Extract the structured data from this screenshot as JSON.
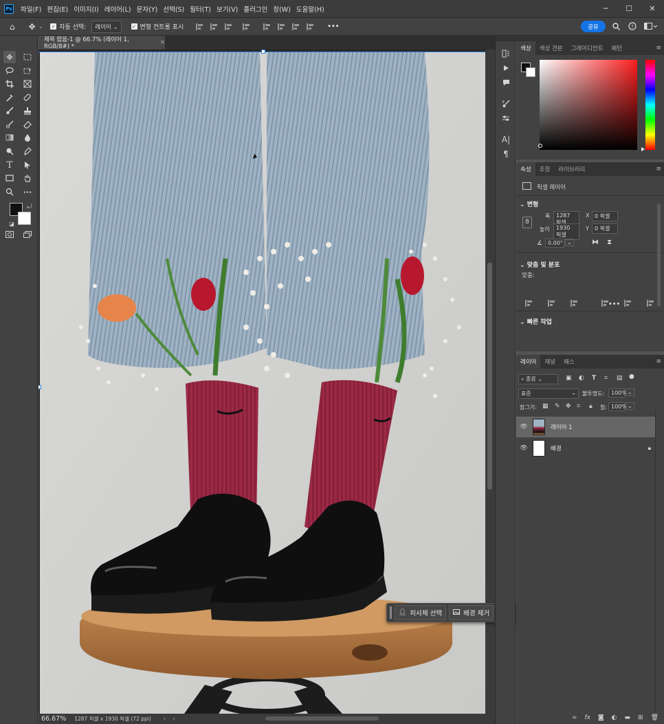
{
  "app": {
    "logo": "Ps"
  },
  "menu": [
    "파일(F)",
    "편집(E)",
    "이미지(I)",
    "레이어(L)",
    "문자(Y)",
    "선택(S)",
    "필터(T)",
    "보기(V)",
    "플러그인",
    "창(W)",
    "도움말(H)"
  ],
  "window_controls": {
    "minimize": "─",
    "maximize": "☐",
    "close": "✕"
  },
  "options_bar": {
    "auto_select_label": "자동 선택:",
    "auto_select_value": "레이어",
    "transform_controls_label": "변형 컨트롤 표시",
    "more": "•••",
    "share_label": "공유"
  },
  "document": {
    "tab_title": "제목 없음-1 @ 66.7% (레이어 1, RGB/8#) *",
    "tab_close": "×",
    "zoom": "66.67%",
    "doc_info": "1287 픽셀 x 1930 픽셀 (72 ppi)"
  },
  "context_bar": {
    "select_subject": "피사체 선택",
    "remove_background": "배경 제거",
    "more": "•••"
  },
  "color_panel": {
    "tabs": [
      "색상",
      "색상 견본",
      "그레이디언트",
      "패턴"
    ],
    "foreground": "#111111",
    "background": "#ffffff",
    "hue": "#ff1e1e"
  },
  "properties_panel": {
    "tabs": [
      "속성",
      "조정",
      "라이브러리"
    ],
    "kind": "픽셀 레이어",
    "transform_header": "변형",
    "width_label": "폭",
    "width_value": "1287 픽셀",
    "height_label": "높이",
    "height_value": "1930 픽셀",
    "x_label": "X",
    "x_value": "0 픽셀",
    "y_label": "Y",
    "y_value": "0 픽셀",
    "angle_value": "0.00°",
    "align_header": "맞춤 및 분포",
    "align_label": "맞춤:",
    "more": "•••",
    "quick_actions_header": "빠른 작업"
  },
  "layers_panel": {
    "tabs": [
      "레이어",
      "채널",
      "패스"
    ],
    "filter_kind": "종류",
    "blend_mode": "표준",
    "opacity_label": "불투명도:",
    "opacity_value": "100%",
    "lock_label": "잠그기:",
    "fill_label": "칠:",
    "fill_value": "100%",
    "layers": [
      {
        "name": "레이어 1",
        "selected": true
      },
      {
        "name": "배경",
        "locked": true
      }
    ]
  }
}
